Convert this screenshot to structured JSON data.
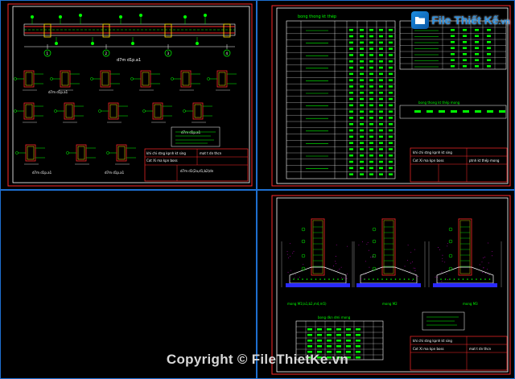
{
  "watermark": {
    "brand": "File Thiết Kế",
    "brand_suffix": ".vn",
    "copyright": "Copyright © FileThietKe.vn"
  },
  "sheets": {
    "top_left": {
      "frame_plan": "d7m d1p.a1",
      "section_labels": [
        "d7m d1p.a1",
        "d7m d1p.a1",
        "d7m d1p.a1",
        "d7m d1p.a1"
      ],
      "grid_axes": [
        "1",
        "2",
        "3",
        "4"
      ],
      "title_block": {
        "rows": [
          "khi chi stng kpnh kt sing",
          "Cot Xi ma kpn boss",
          "d7m d1(2a,d1,b2)dn"
        ],
        "right": "mat t dn thcn"
      }
    },
    "top_right": {
      "table_title": "bong thong kt thép",
      "table2_title": "bong thong kt thép mong",
      "title_block": {
        "rows": [
          "khi chi stng kpnh kt sing",
          "Cot Xi ma kpn boss"
        ],
        "right": "ptnh kt thép mong"
      }
    },
    "bottom_right": {
      "footings": [
        "mong M1(a1,b2,m4,m5)",
        "mong M2",
        "mong M3"
      ],
      "table_title": "bong dkn dmi mong",
      "title_block": {
        "rows": [
          "khi chi stng kpnh kt sing",
          "Cot Xi ma kpn boss"
        ],
        "right": "mat t dn thcn"
      }
    }
  },
  "colors": {
    "background": "#000000",
    "viewport_border": "#1e6fd0",
    "sheet_frame_outer": "#ff2a2a",
    "sheet_frame_inner": "#ffffff",
    "rebar": "#00ff00",
    "dims": "#ffffff",
    "accent_yellow": "#ffe600",
    "concrete_hatch": "#ff00ff",
    "ground_blue": "#2a2aff"
  }
}
